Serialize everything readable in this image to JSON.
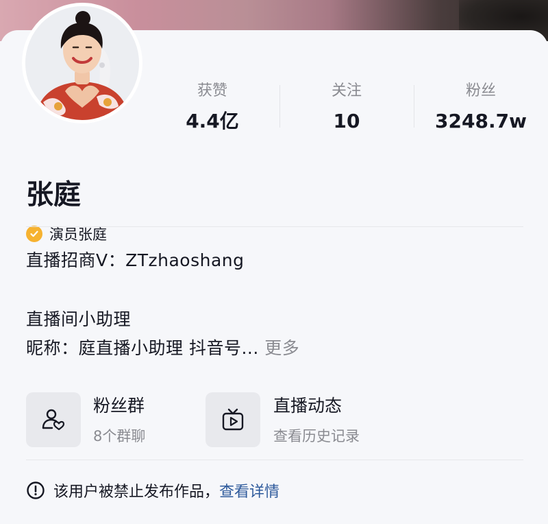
{
  "profile": {
    "name": "张庭",
    "verification": "演员张庭",
    "avatar_icon": "avatar-photo"
  },
  "stats": [
    {
      "label": "获赞",
      "value": "4.4亿"
    },
    {
      "label": "关注",
      "value": "10"
    },
    {
      "label": "粉丝",
      "value": "3248.7w"
    }
  ],
  "bio": {
    "line1": "直播招商V：ZTzhaoshang",
    "line2": "直播间小助理",
    "line3": "昵称：庭直播小助理   抖音号...",
    "more": " 更多"
  },
  "tiles": [
    {
      "icon": "fan-group-icon",
      "title": "粉丝群",
      "subtitle": "8个群聊"
    },
    {
      "icon": "live-tv-icon",
      "title": "直播动态",
      "subtitle": "查看历史记录"
    }
  ],
  "notice": {
    "icon": "exclamation-circle-icon",
    "text": "该用户被禁止发布作品，",
    "link": "查看详情"
  },
  "colors": {
    "verify_badge": "#f6b230",
    "link": "#2f5b9c",
    "muted": "#8a8b91"
  }
}
